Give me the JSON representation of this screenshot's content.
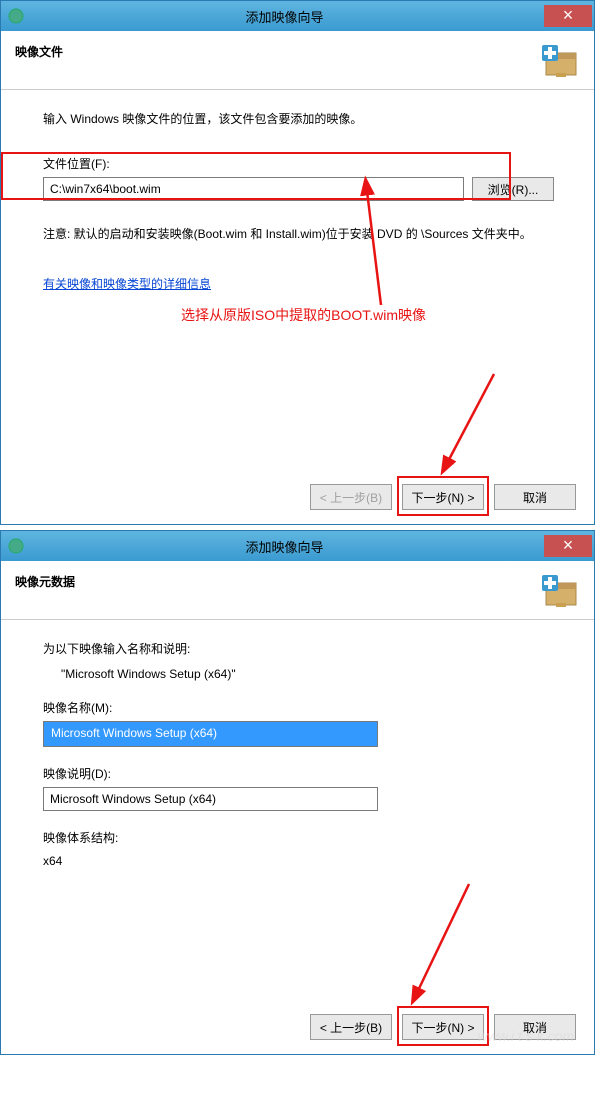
{
  "dialog1": {
    "title": "添加映像向导",
    "header": "映像文件",
    "instruction": "输入 Windows 映像文件的位置，该文件包含要添加的映像。",
    "fileLabel": "文件位置(F):",
    "fileValue": "C:\\win7x64\\boot.wim",
    "browseLabel": "浏览(R)...",
    "note": "注意: 默认的启动和安装映像(Boot.wim 和 Install.wim)位于安装 DVD 的 \\Sources 文件夹中。",
    "linkText": "有关映像和映像类型的详细信息",
    "annotation": "选择从原版ISO中提取的BOOT.wim映像",
    "backBtn": "< 上一步(B)",
    "nextBtn": "下一步(N) >",
    "cancelBtn": "取消"
  },
  "dialog2": {
    "title": "添加映像向导",
    "header": "映像元数据",
    "instruction": "为以下映像输入名称和说明:",
    "imageName": "\"Microsoft Windows Setup (x64)\"",
    "nameLabel": "映像名称(M):",
    "nameValue": "Microsoft Windows Setup (x64)",
    "descLabel": "映像说明(D):",
    "descValue": "Microsoft Windows Setup (x64)",
    "archLabel": "映像体系结构:",
    "archValue": "x64",
    "backBtn": "< 上一步(B)",
    "nextBtn": "下一步(N) >",
    "cancelBtn": "取消",
    "watermark": "www.i t s k.com"
  }
}
